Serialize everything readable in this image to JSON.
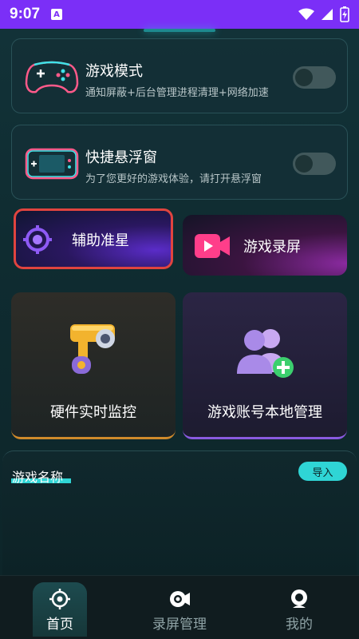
{
  "status_bar": {
    "time": "9:07",
    "notification_letter": "A",
    "icons": [
      "wifi-icon",
      "signal-icon",
      "battery-charging-icon"
    ],
    "background": "#7b2ff7"
  },
  "features": [
    {
      "title": "游戏模式",
      "subtitle": "通知屏蔽+后台管理进程清理+网络加速",
      "icon": "gamepad-icon",
      "enabled": false
    },
    {
      "title": "快捷悬浮窗",
      "subtitle": "为了您更好的游戏体验，请打开悬浮窗",
      "icon": "handheld-console-icon",
      "enabled": false
    }
  ],
  "tiles": {
    "aim_assist": {
      "label": "辅助准星",
      "icon": "crosshair-icon"
    },
    "game_record": {
      "label": "游戏录屏",
      "icon": "video-camera-icon"
    },
    "hardware_monitor": {
      "label": "硬件实时监控",
      "icon": "security-camera-icon"
    },
    "account_manager": {
      "label": "游戏账号本地管理",
      "icon": "add-users-icon"
    }
  },
  "games_panel": {
    "title": "游戏名称",
    "import_label": "导入"
  },
  "bottom_nav": {
    "items": [
      {
        "label": "首页",
        "icon": "crosshair-home-icon",
        "active": true
      },
      {
        "label": "录屏管理",
        "icon": "record-icon",
        "active": false
      },
      {
        "label": "我的",
        "icon": "profile-icon",
        "active": false
      }
    ]
  },
  "colors": {
    "accent_cyan": "#2fd5d5",
    "highlight_red": "#e0443f",
    "card_bg": "#14303a"
  }
}
